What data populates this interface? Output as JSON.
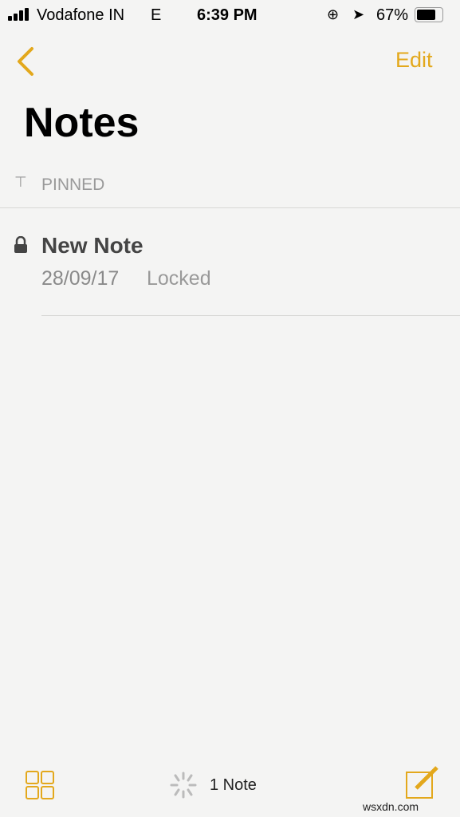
{
  "status": {
    "carrier": "Vodafone IN",
    "network": "E",
    "time": "6:39 PM",
    "battery": "67%",
    "battery_level": 0.67
  },
  "nav": {
    "back_icon": "chevron-left-icon",
    "edit_label": "Edit"
  },
  "title": "Notes",
  "pinned": {
    "label": "PINNED",
    "icon": "pin-icon"
  },
  "notes": [
    {
      "title": "New Note",
      "date": "28/09/17",
      "status": "Locked",
      "icon": "lock-icon"
    }
  ],
  "toolbar": {
    "count": "1 Note",
    "folders_icon": "grid-icon",
    "compose_icon": "compose-icon",
    "spinner": "spinner-icon"
  },
  "watermark": "wsxdn.com",
  "colors": {
    "accent": "#e3a81c"
  }
}
